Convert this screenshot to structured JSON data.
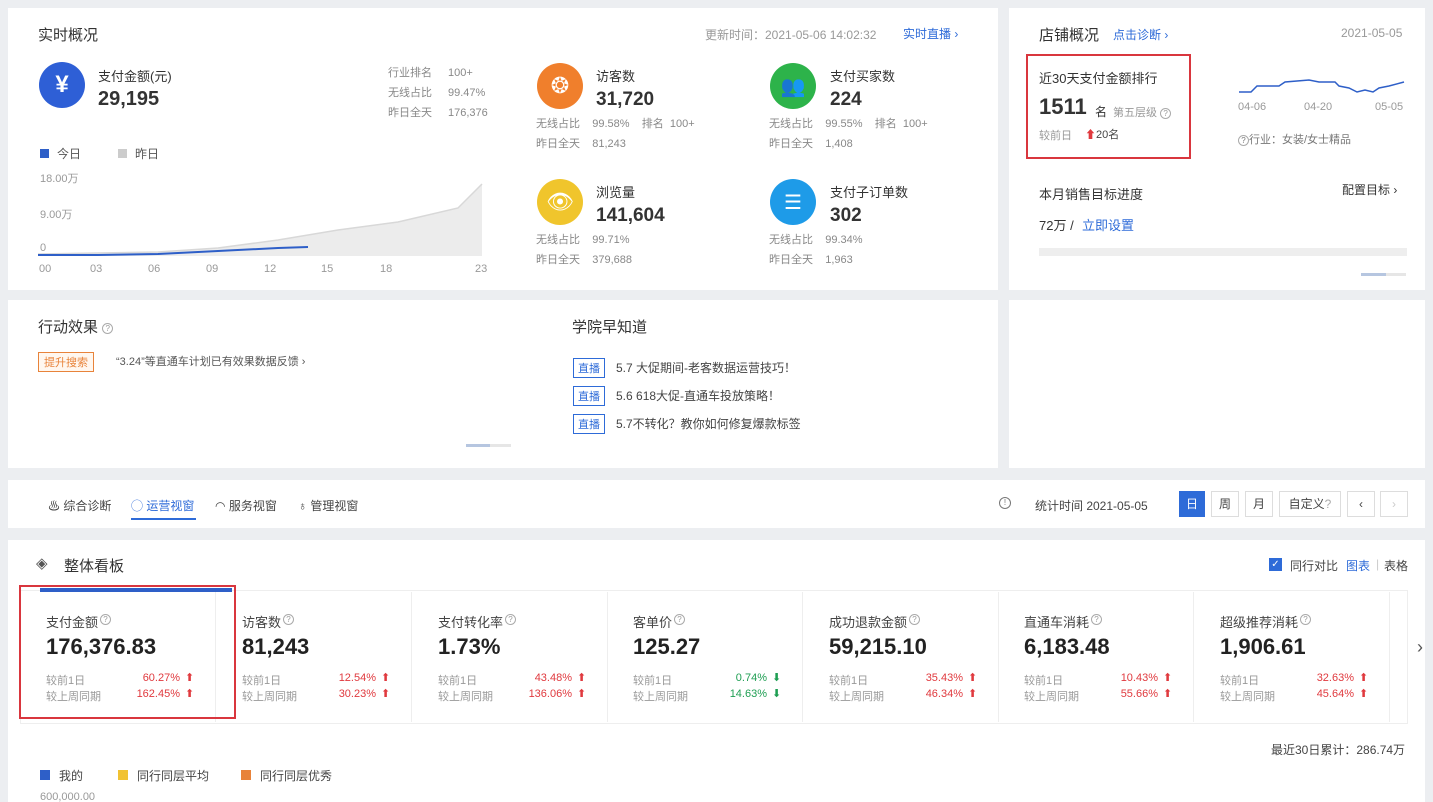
{
  "realtime": {
    "title": "实时概况",
    "update_label": "更新时间：2021-05-06 14:02:32",
    "live_link": "实时直播",
    "pay": {
      "label": "支付金额(元)",
      "value": "29,195",
      "rank_label": "行业排名",
      "rank_value": "100+",
      "wireless_label": "无线占比",
      "wireless_value": "99.47%",
      "yday_label": "昨日全天",
      "yday_value": "176,376"
    },
    "legend_today": "今日",
    "legend_yday": "昨日",
    "y_ticks": [
      "18.00万",
      "9.00万",
      "0"
    ],
    "x_ticks": [
      "00",
      "03",
      "06",
      "09",
      "12",
      "15",
      "18",
      "23"
    ],
    "visitors": {
      "label": "访客数",
      "value": "31,720",
      "wl": "无线占比",
      "wl_v": "99.58%",
      "rk": "排名",
      "rk_v": "100+",
      "yd": "昨日全天",
      "yd_v": "81,243"
    },
    "buyers": {
      "label": "支付买家数",
      "value": "224",
      "wl": "无线占比",
      "wl_v": "99.55%",
      "rk": "排名",
      "rk_v": "100+",
      "yd": "昨日全天",
      "yd_v": "1,408"
    },
    "pv": {
      "label": "浏览量",
      "value": "141,604",
      "wl": "无线占比",
      "wl_v": "99.71%",
      "yd": "昨日全天",
      "yd_v": "379,688"
    },
    "suborders": {
      "label": "支付子订单数",
      "value": "302",
      "wl": "无线占比",
      "wl_v": "99.34%",
      "yd": "昨日全天",
      "yd_v": "1,963"
    }
  },
  "shop": {
    "title": "店铺概况",
    "diagnose": "点击诊断",
    "date": "2021-05-05",
    "rank_title": "近30天支付金额排行",
    "rank_value": "1511",
    "rank_unit": "名",
    "tier": "第五层级",
    "compare_label": "较前日",
    "compare_value": "20名",
    "x_ticks": [
      "04-06",
      "04-20",
      "05-05"
    ],
    "industry": "行业：女装/女士精品",
    "target_title": "本月销售目标进度",
    "target_config": "配置目标",
    "target_amount": "72万 /",
    "target_set": "立即设置"
  },
  "action": {
    "title": "行动效果",
    "tag": "提升搜索",
    "text": "“3.24”等直通车计划已有效果数据反馈"
  },
  "academy": {
    "title": "学院早知道",
    "items": [
      {
        "tag": "直播",
        "text": "5.7 大促期间-老客数据运营技巧！"
      },
      {
        "tag": "直播",
        "text": "5.6 618大促-直通车投放策略！"
      },
      {
        "tag": "直播",
        "text": "5.7不转化？教你如何修复爆款标签"
      }
    ]
  },
  "tabs": [
    "综合诊断",
    "运营视窗",
    "服务视窗",
    "管理视窗"
  ],
  "stat": {
    "label": "统计时间 2021-05-05",
    "day": "日",
    "week": "周",
    "month": "月",
    "custom": "自定义"
  },
  "board": {
    "title": "整体看板",
    "peer_compare": "同行对比",
    "chart_view": "图表",
    "sep": "|",
    "table_view": "表格",
    "total": "最近30日累计：286.74万",
    "cmp1": "较前1日",
    "cmp2": "较上周同期",
    "metrics": [
      {
        "label": "支付金额",
        "value": "176,376.83",
        "d1": "60.27%",
        "d1_dir": "up",
        "w1": "162.45%",
        "w1_dir": "up"
      },
      {
        "label": "访客数",
        "value": "81,243",
        "d1": "12.54%",
        "d1_dir": "up",
        "w1": "30.23%",
        "w1_dir": "up"
      },
      {
        "label": "支付转化率",
        "value": "1.73%",
        "d1": "43.48%",
        "d1_dir": "up",
        "w1": "136.06%",
        "w1_dir": "up"
      },
      {
        "label": "客单价",
        "value": "125.27",
        "d1": "0.74%",
        "d1_dir": "down",
        "w1": "14.63%",
        "w1_dir": "down"
      },
      {
        "label": "成功退款金额",
        "value": "59,215.10",
        "d1": "35.43%",
        "d1_dir": "up",
        "w1": "46.34%",
        "w1_dir": "up"
      },
      {
        "label": "直通车消耗",
        "value": "6,183.48",
        "d1": "10.43%",
        "d1_dir": "up",
        "w1": "55.66%",
        "w1_dir": "up"
      },
      {
        "label": "超级推荐消耗",
        "value": "1,906.61",
        "d1": "32.63%",
        "d1_dir": "up",
        "w1": "45.64%",
        "w1_dir": "up"
      }
    ],
    "legend": [
      {
        "name": "我的",
        "color": "#2e5fc8"
      },
      {
        "name": "同行同层平均",
        "color": "#f1c232"
      },
      {
        "name": "同行同层优秀",
        "color": "#e8833a"
      }
    ],
    "y_top": "600,000.00"
  },
  "colors": {
    "accent": "#2e6bd8",
    "red": "#d9363e",
    "up": "#e0393e",
    "down": "#1e9e52"
  }
}
